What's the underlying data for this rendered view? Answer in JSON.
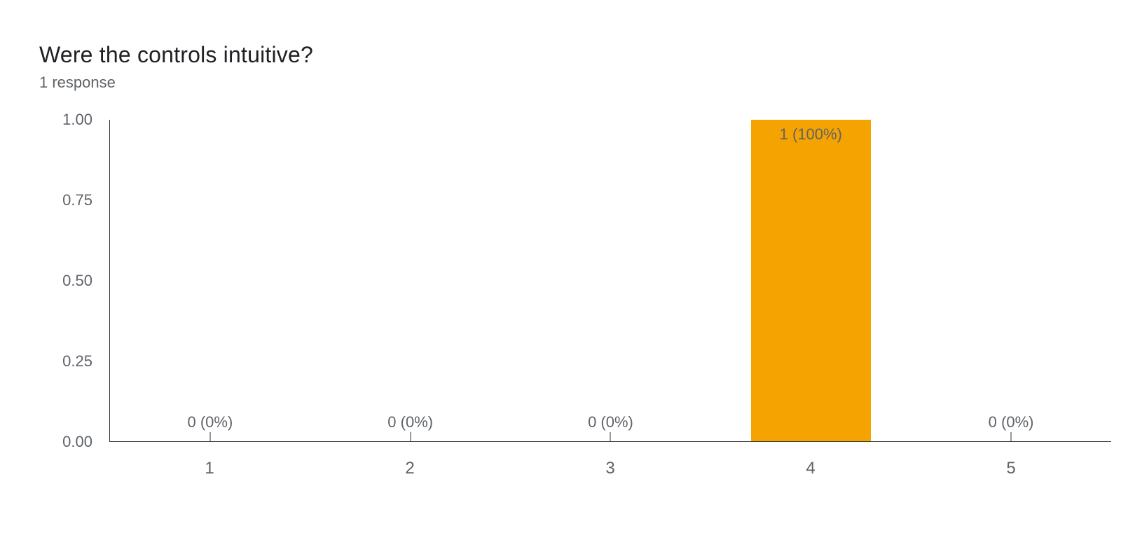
{
  "title": "Were the controls intuitive?",
  "subtitle": "1 response",
  "chart_data": {
    "type": "bar",
    "categories": [
      "1",
      "2",
      "3",
      "4",
      "5"
    ],
    "values": [
      0,
      0,
      0,
      1,
      0
    ],
    "data_labels": [
      "0 (0%)",
      "0 (0%)",
      "0 (0%)",
      "1 (100%)",
      "0 (0%)"
    ],
    "title": "Were the controls intuitive?",
    "xlabel": "",
    "ylabel": "",
    "ylim": [
      0,
      1
    ],
    "yticks": [
      "0.00",
      "0.25",
      "0.50",
      "0.75",
      "1.00"
    ],
    "colors": {
      "bar": "#f5a300"
    }
  }
}
